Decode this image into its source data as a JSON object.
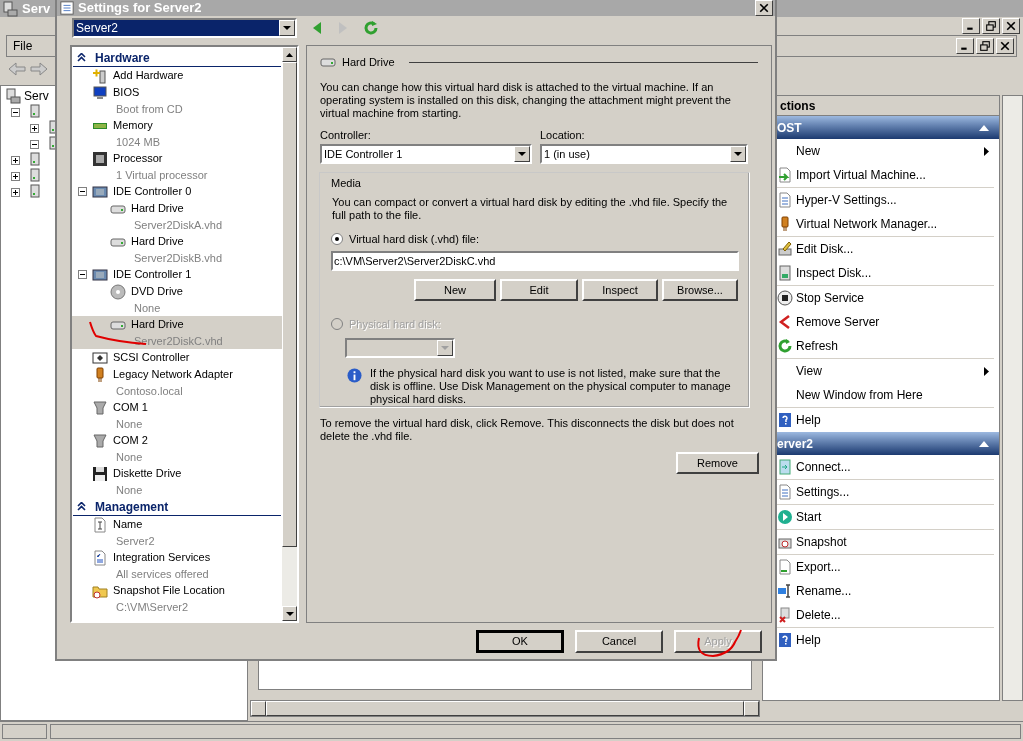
{
  "background_window": {
    "title": "Serv",
    "menu": [
      "File"
    ],
    "tree": {
      "label": "Serv",
      "nodes": [
        {
          "expanded": true,
          "children": [
            {
              "expanded": false
            },
            {
              "expanded": true
            }
          ]
        },
        {
          "expanded": false
        },
        {
          "expanded": false
        },
        {
          "expanded": false
        }
      ]
    },
    "actions": {
      "header": "ctions",
      "groups": [
        {
          "title": "OST",
          "expanded": true,
          "blocks": [
            [
              {
                "label": "New",
                "submenu": true
              },
              {
                "label": "Import Virtual Machine...",
                "kind": "import"
              }
            ],
            [
              {
                "label": "Hyper-V Settings...",
                "kind": "settings"
              },
              {
                "label": "Virtual Network Manager...",
                "kind": "network"
              }
            ],
            [
              {
                "label": "Edit Disk...",
                "kind": "edit"
              },
              {
                "label": "Inspect Disk...",
                "kind": "inspect"
              }
            ],
            [
              {
                "label": "Stop Service",
                "kind": "stop"
              },
              {
                "label": "Remove Server",
                "kind": "remove"
              },
              {
                "label": "Refresh",
                "kind": "refresh"
              }
            ],
            [
              {
                "label": "View",
                "submenu": true
              },
              {
                "label": "New Window from Here"
              }
            ],
            [
              {
                "label": "Help",
                "kind": "help"
              }
            ]
          ]
        },
        {
          "title": "erver2",
          "expanded": true,
          "blocks": [
            [
              {
                "label": "Connect...",
                "kind": "connect"
              }
            ],
            [
              {
                "label": "Settings...",
                "kind": "settings"
              }
            ],
            [
              {
                "label": "Start",
                "kind": "start"
              }
            ],
            [
              {
                "label": "Snapshot",
                "kind": "snapshot"
              }
            ],
            [
              {
                "label": "Export...",
                "kind": "export"
              },
              {
                "label": "Rename...",
                "kind": "rename"
              },
              {
                "label": "Delete...",
                "kind": "delete"
              }
            ],
            [
              {
                "label": "Help",
                "kind": "help"
              }
            ]
          ]
        }
      ]
    }
  },
  "dialog": {
    "title": "Settings for Server2",
    "vm_selector": "Server2",
    "settings_tree": [
      {
        "title": "Hardware",
        "expanded": true,
        "items": [
          {
            "label": "Add Hardware",
            "kind": "add-hardware",
            "selected": false
          },
          {
            "label": "BIOS",
            "detail": "Boot from CD",
            "kind": "bios",
            "selected": false
          },
          {
            "label": "Memory",
            "detail": "1024 MB",
            "kind": "memory",
            "selected": false
          },
          {
            "label": "Processor",
            "detail": "1 Virtual processor",
            "kind": "processor",
            "selected": false
          },
          {
            "label": "IDE Controller 0",
            "kind": "controller",
            "selected": false,
            "expanded": true,
            "children": [
              {
                "label": "Hard Drive",
                "detail": "Server2DiskA.vhd",
                "kind": "hard-drive",
                "selected": false
              },
              {
                "label": "Hard Drive",
                "detail": "Server2DiskB.vhd",
                "kind": "hard-drive",
                "selected": false
              }
            ]
          },
          {
            "label": "IDE Controller 1",
            "kind": "controller",
            "selected": false,
            "expanded": true,
            "children": [
              {
                "label": "DVD Drive",
                "detail": "None",
                "kind": "dvd",
                "selected": false
              },
              {
                "label": "Hard Drive",
                "detail": "Server2DiskC.vhd",
                "kind": "hard-drive",
                "selected": true
              }
            ]
          },
          {
            "label": "SCSI Controller",
            "kind": "scsi",
            "selected": false
          },
          {
            "label": "Legacy Network Adapter",
            "detail": "Contoso.local",
            "kind": "network",
            "selected": false
          },
          {
            "label": "COM 1",
            "detail": "None",
            "kind": "com",
            "selected": false
          },
          {
            "label": "COM 2",
            "detail": "None",
            "kind": "com",
            "selected": false
          },
          {
            "label": "Diskette Drive",
            "detail": "None",
            "kind": "diskette",
            "selected": false
          }
        ]
      },
      {
        "title": "Management",
        "expanded": true,
        "items": [
          {
            "label": "Name",
            "detail": "Server2",
            "kind": "name",
            "selected": false
          },
          {
            "label": "Integration Services",
            "detail": "All services offered",
            "kind": "integration",
            "selected": false
          },
          {
            "label": "Snapshot File Location",
            "detail": "C:\\VM\\Server2",
            "kind": "folder",
            "selected": false
          }
        ]
      }
    ],
    "hard_drive_panel": {
      "title": "Hard Drive",
      "description": "You can change how this virtual hard disk is attached to the virtual machine. If an operating system is installed on this disk, changing the attachment might prevent the virtual machine from starting.",
      "controller": {
        "label": "Controller:",
        "value": "IDE Controller 1"
      },
      "location": {
        "label": "Location:",
        "value": "1 (in use)"
      },
      "media": {
        "title": "Media",
        "description": "You can compact or convert a virtual hard disk by editing the .vhd file. Specify the full path to the file.",
        "options": [
          {
            "label": "Virtual hard disk (.vhd) file:",
            "selected": true,
            "disabled": false
          },
          {
            "label": "Physical hard disk:",
            "selected": false,
            "disabled": true
          }
        ],
        "path": "c:\\VM\\Server2\\Server2DiskC.vhd",
        "buttons": [
          "New",
          "Edit",
          "Inspect",
          "Browse..."
        ],
        "info": "If the physical hard disk you want to use is not listed, make sure that the disk is offline. Use Disk Management on the physical computer to manage physical hard disks."
      },
      "remove_text": "To remove the virtual hard disk, click Remove. This disconnects the disk but does not delete the .vhd file.",
      "remove_button": "Remove"
    },
    "buttons": [
      {
        "label": "OK",
        "default": true,
        "disabled": false
      },
      {
        "label": "Cancel",
        "default": false,
        "disabled": false
      },
      {
        "label": "Apply",
        "default": false,
        "disabled": true
      }
    ]
  }
}
